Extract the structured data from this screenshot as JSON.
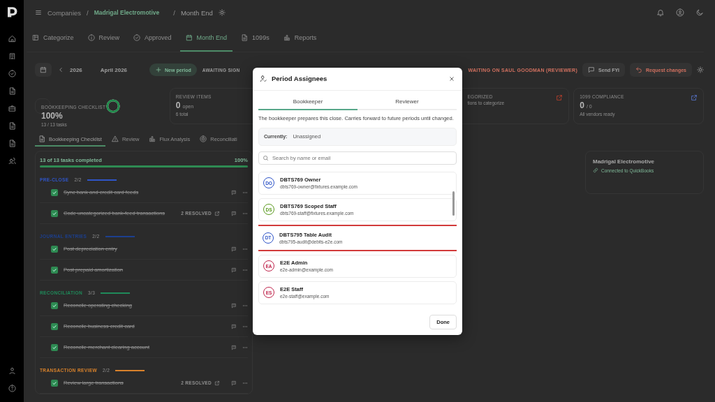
{
  "breadcrumb": [
    {
      "kind": "link",
      "label": "Companies"
    },
    {
      "kind": "sep",
      "label": "/"
    },
    {
      "kind": "company",
      "label": "Madrigal Electromotive"
    },
    {
      "kind": "sep",
      "label": "/"
    },
    {
      "kind": "current",
      "label": "Month End"
    }
  ],
  "tabs": [
    {
      "label": "Categorize",
      "selected": false
    },
    {
      "label": "Review",
      "selected": false
    },
    {
      "label": "Approved",
      "selected": false
    },
    {
      "label": "Month End",
      "selected": true
    },
    {
      "label": "1099s",
      "selected": false
    },
    {
      "label": "Reports",
      "selected": false
    }
  ],
  "period_bar": {
    "year": "2026",
    "month": "April 2026",
    "new_period": "New period",
    "status": "AWAITING SIGN",
    "waiting": "WAITING ON SAUL GOODMAN (REVIEWER)",
    "send": "Send FYI",
    "request": "Request changes"
  },
  "stats": [
    {
      "kind": "ring",
      "label": "BOOKKEEPING CHECKLIST",
      "value": "100%",
      "sub": "13 / 13 tasks",
      "level": 1
    },
    {
      "kind": "count",
      "label": "REVIEW ITEMS",
      "value": "0",
      "unit": "open",
      "sub": "6 total"
    },
    {
      "kind": "partial",
      "label": "EGORIZED",
      "sub": "tions to categorize"
    },
    {
      "kind": "link",
      "label": "1099 COMPLIANCE",
      "value": "0",
      "unit": "/ 0",
      "sub": "All vendors ready"
    }
  ],
  "subtabs": [
    {
      "label": "Bookkeeping Checklist",
      "selected": true
    },
    {
      "label": "Review",
      "selected": false
    },
    {
      "label": "Flux Analysis",
      "selected": false
    },
    {
      "label": "Reconciliati",
      "selected": false
    }
  ],
  "checklist": {
    "summary": "13 of 13 tasks completed",
    "percent": "100%",
    "level": 1,
    "sections": [
      {
        "name": "PRE-CLOSE",
        "count": "2/2",
        "color": "#2f55c8",
        "level": 1,
        "tasks": [
          {
            "label": "Sync bank and credit card feeds",
            "done": true
          },
          {
            "label": "Code uncategorized bank-feed transactions",
            "done": true,
            "badge": "2 RESOLVED"
          }
        ]
      },
      {
        "name": "JOURNAL ENTRIES",
        "count": "2/2",
        "color": "#1c3f8f",
        "level": 1,
        "tasks": [
          {
            "label": "Post depreciation entry",
            "done": true
          },
          {
            "label": "Post prepaid amortization",
            "done": true
          }
        ]
      },
      {
        "name": "RECONCILIATION",
        "count": "3/3",
        "color": "#1f8a5a",
        "level": 1,
        "tasks": [
          {
            "label": "Reconcile operating checking",
            "done": true
          },
          {
            "label": "Reconcile business credit card",
            "done": true
          },
          {
            "label": "Reconcile merchant clearing account",
            "done": true
          }
        ]
      },
      {
        "name": "TRANSACTION REVIEW",
        "count": "2/2",
        "color": "#d9822b",
        "level": 1,
        "tasks": [
          {
            "label": "Review large transactions",
            "done": true,
            "badge": "2 RESOLVED"
          }
        ]
      }
    ]
  },
  "company_panel": {
    "name": "Madrigal Electromotive",
    "status": "Connected to QuickBooks"
  },
  "modal": {
    "title": "Period Assignees",
    "tabs": [
      {
        "label": "Bookkeeper",
        "selected": true
      },
      {
        "label": "Reviewer",
        "selected": false
      }
    ],
    "description": "The bookkeeper prepares this close. Carries forward to future periods until changed.",
    "current_label": "Currently:",
    "current_value": "Unassigned",
    "search_placeholder": "Search by name or email",
    "people": [
      {
        "initials": "DO",
        "name": "DBTS769 Owner",
        "email": "dbts769-owner@fixtures.example.com",
        "color": "#2f55c8",
        "highlighted": false
      },
      {
        "initials": "DS",
        "name": "DBTS769 Scoped Staff",
        "email": "dbts769-staff@fixtures.example.com",
        "color": "#5a9a1e",
        "highlighted": false
      },
      {
        "initials": "DT",
        "name": "DBTS795 Table Audit",
        "email": "dbts795-audit@debits-e2e.com",
        "color": "#2f55c8",
        "highlighted": true
      },
      {
        "initials": "EA",
        "name": "E2E Admin",
        "email": "e2e-admin@example.com",
        "color": "#c0264d",
        "highlighted": false
      },
      {
        "initials": "ES",
        "name": "E2E Staff",
        "email": "e2e-staff@example.com",
        "color": "#c0264d",
        "highlighted": false
      }
    ],
    "done": "Done"
  }
}
